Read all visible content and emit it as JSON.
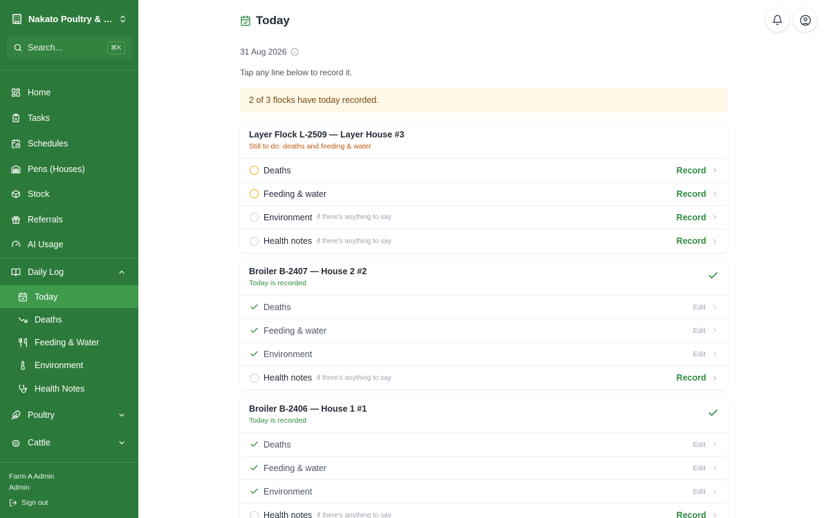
{
  "sidebar": {
    "farm_name": "Nakato Poultry & Dairy",
    "search_placeholder": "Search...",
    "search_shortcut": "⌘K",
    "nav": [
      {
        "label": "Home",
        "icon": "grid-icon"
      },
      {
        "label": "Tasks",
        "icon": "clipboard-icon"
      },
      {
        "label": "Schedules",
        "icon": "calendar-clock-icon"
      },
      {
        "label": "Pens (Houses)",
        "icon": "warehouse-icon"
      },
      {
        "label": "Stock",
        "icon": "box-icon"
      },
      {
        "label": "Referrals",
        "icon": "gift-icon"
      },
      {
        "label": "AI Usage",
        "icon": "gauge-icon"
      }
    ],
    "daily_log": {
      "label": "Daily Log",
      "icon": "book-open-icon",
      "expanded": true,
      "items": [
        {
          "label": "Today",
          "icon": "calendar-check-icon",
          "active": true
        },
        {
          "label": "Deaths",
          "icon": "trending-down-icon"
        },
        {
          "label": "Feeding & Water",
          "icon": "utensils-icon"
        },
        {
          "label": "Environment",
          "icon": "thermometer-icon"
        },
        {
          "label": "Health Notes",
          "icon": "stethoscope-icon"
        }
      ]
    },
    "groups": [
      {
        "label": "Poultry",
        "icon": "feather-icon",
        "expanded": false
      },
      {
        "label": "Cattle",
        "icon": "cattle-icon",
        "expanded": false
      }
    ],
    "user": {
      "name": "Farm A Admin",
      "role": "Admin",
      "signout_label": "Sign out"
    }
  },
  "header": {
    "title": "Today",
    "date": "31 Aug 2026",
    "hint": "Tap any line below to record it."
  },
  "banner": {
    "text": "2 of 3 flocks have today recorded."
  },
  "flocks": [
    {
      "name": "Layer Flock L-2509 — Layer House #3",
      "status": "Still to do: deaths and feeding & water",
      "complete": false,
      "rows": [
        {
          "label": "Deaths",
          "state": "pending",
          "note": "",
          "action": "Record"
        },
        {
          "label": "Feeding & water",
          "state": "pending",
          "note": "",
          "action": "Record"
        },
        {
          "label": "Environment",
          "state": "optional",
          "note": "if there's anything to say",
          "action": "Record"
        },
        {
          "label": "Health notes",
          "state": "optional",
          "note": "if there's anything to say",
          "action": "Record"
        }
      ]
    },
    {
      "name": "Broiler B-2407 — House 2 #2",
      "status": "Today is recorded",
      "complete": true,
      "rows": [
        {
          "label": "Deaths",
          "state": "done",
          "note": "",
          "action": "Edit"
        },
        {
          "label": "Feeding & water",
          "state": "done",
          "note": "",
          "action": "Edit"
        },
        {
          "label": "Environment",
          "state": "done",
          "note": "",
          "action": "Edit"
        },
        {
          "label": "Health notes",
          "state": "optional",
          "note": "if there's anything to say",
          "action": "Record"
        }
      ]
    },
    {
      "name": "Broiler B-2406 — House 1 #1",
      "status": "Today is recorded",
      "complete": true,
      "rows": [
        {
          "label": "Deaths",
          "state": "done",
          "note": "",
          "action": "Edit"
        },
        {
          "label": "Feeding & water",
          "state": "done",
          "note": "",
          "action": "Edit"
        },
        {
          "label": "Environment",
          "state": "done",
          "note": "",
          "action": "Edit"
        },
        {
          "label": "Health notes",
          "state": "optional",
          "note": "if there's anything to say",
          "action": "Record"
        }
      ]
    }
  ],
  "colors": {
    "sidebar_bg": "#2c7a3a",
    "sidebar_active": "#3f9a4c",
    "accent_green": "#2e8b41",
    "pending_yellow": "#eab308",
    "todo_orange": "#c2550f",
    "banner_bg": "#fdf8e6"
  }
}
